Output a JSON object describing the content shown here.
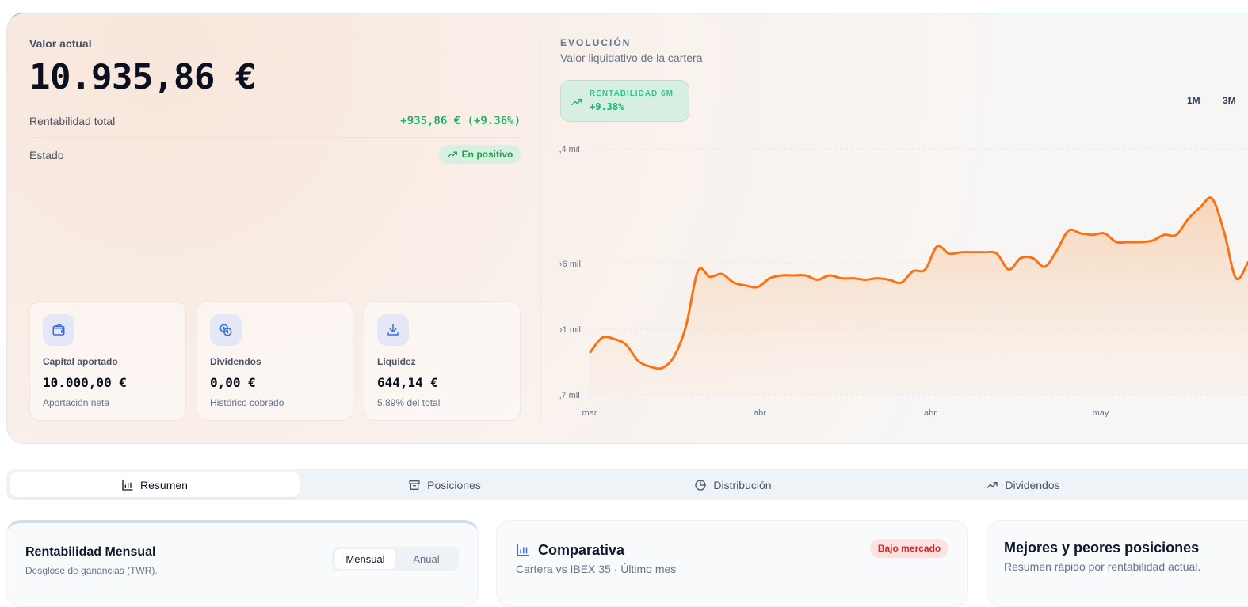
{
  "summary": {
    "value_label": "Valor actual",
    "value": "10.935,86 €",
    "rent_label": "Rentabilidad total",
    "rent_value": "+935,86 € (+9.36%)",
    "status_label": "Estado",
    "status_badge": "En positivo"
  },
  "stats": [
    {
      "title": "Capital aportado",
      "value": "10.000,00 €",
      "sub": "Aportación neta",
      "icon": "wallet-icon"
    },
    {
      "title": "Dividendos",
      "value": "0,00 €",
      "sub": "Histórico cobrado",
      "icon": "coins-icon"
    },
    {
      "title": "Liquidez",
      "value": "644,14 €",
      "sub": "5.89% del total",
      "icon": "download-icon"
    }
  ],
  "evolution": {
    "title": "EVOLUCIÓN",
    "subtitle": "Valor liquidativo de la cartera",
    "kpi_label": "RENTABILIDAD 6M",
    "kpi_value": "+9.38%",
    "ranges": [
      "1M",
      "3M"
    ]
  },
  "chart_data": {
    "type": "area",
    "title": "",
    "xlabel": "",
    "ylabel": "",
    "y_tick_labels": [
      "‚4 mil",
      "›6 mil",
      "›1 mil",
      "‚7 mil"
    ],
    "x_tick_labels": [
      "mar",
      "abr",
      "abr",
      "may"
    ],
    "ylim": [
      9.7,
      11.4
    ],
    "color": "#f97316",
    "series": [
      {
        "values": [
          9.99,
          10.09,
          10.08,
          10.04,
          9.93,
          9.89,
          9.88,
          9.96,
          10.17,
          10.55,
          10.51,
          10.53,
          10.47,
          10.45,
          10.44,
          10.5,
          10.52,
          10.52,
          10.52,
          10.49,
          10.52,
          10.5,
          10.5,
          10.49,
          10.5,
          10.49,
          10.47,
          10.55,
          10.56,
          10.72,
          10.67,
          10.68,
          10.68,
          10.68,
          10.67,
          10.56,
          10.64,
          10.64,
          10.58,
          10.69,
          10.83,
          10.81,
          10.8,
          10.81,
          10.75,
          10.75,
          10.75,
          10.76,
          10.8,
          10.8,
          10.91,
          10.99,
          11.05,
          10.82,
          10.5,
          10.61
        ]
      }
    ]
  },
  "tabs": [
    {
      "label": "Resumen",
      "icon": "bar-chart-icon",
      "active": true
    },
    {
      "label": "Posiciones",
      "icon": "archive-icon",
      "active": false
    },
    {
      "label": "Distribución",
      "icon": "pie-chart-icon",
      "active": false
    },
    {
      "label": "Dividendos",
      "icon": "trend-up-icon",
      "active": false
    }
  ],
  "cards": {
    "monthly": {
      "title": "Rentabilidad Mensual",
      "subtitle": "Desglose de ganancias (TWR).",
      "toggle": [
        "Mensual",
        "Anual"
      ]
    },
    "compare": {
      "title": "Comparativa",
      "subtitle": "Cartera vs IBEX 35 · Último mes",
      "badge": "Bajo mercado"
    },
    "positions": {
      "title": "Mejores y peores posiciones",
      "subtitle": "Resumen rápido por rentabilidad actual."
    }
  }
}
